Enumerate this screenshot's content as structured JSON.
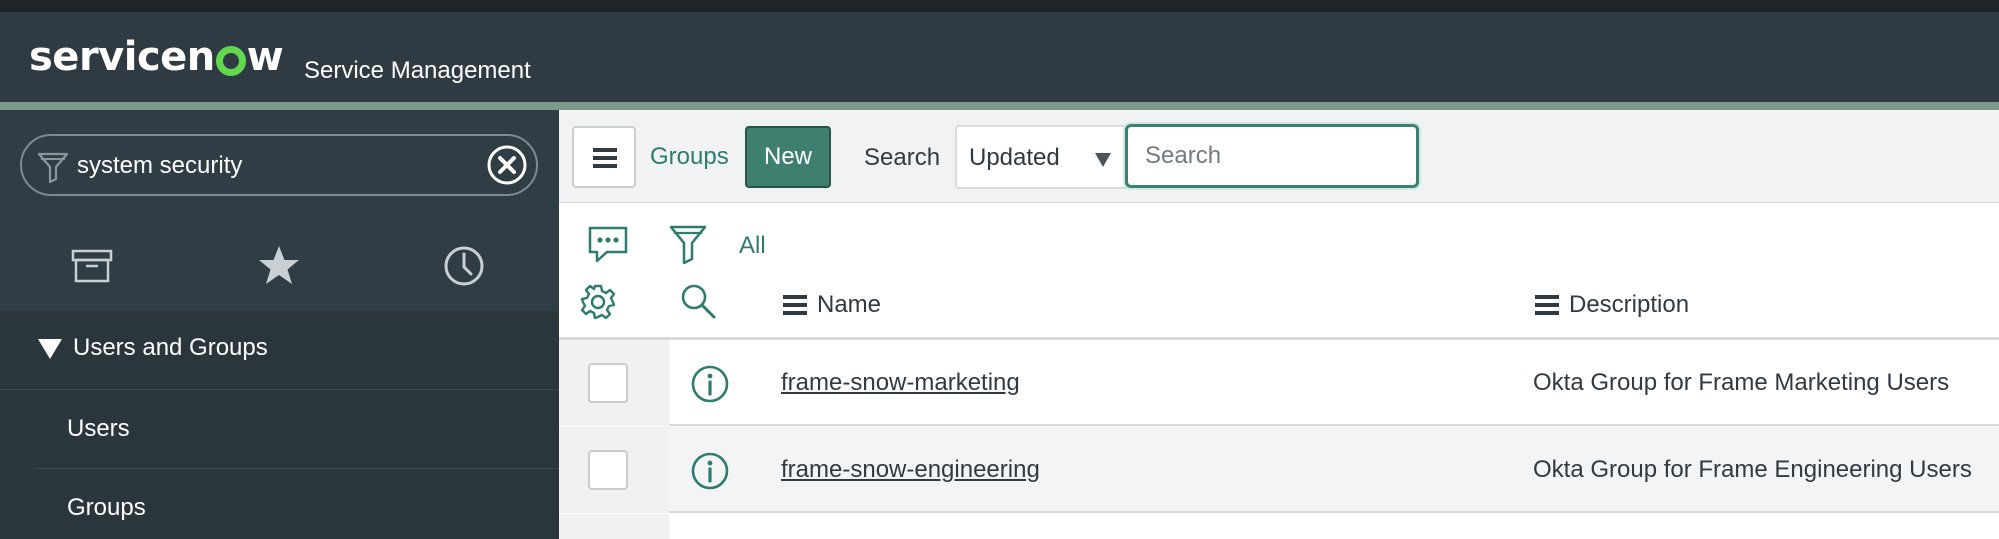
{
  "header": {
    "logo_text": "servicenow",
    "logo_parts": [
      "servicen",
      "w"
    ],
    "app_title": "Service Management",
    "colors": {
      "bar": "#303a42",
      "accent_line": "#7c9a8c",
      "logo_dot": "#62d84e"
    }
  },
  "sidebar": {
    "filter": {
      "value": "system security",
      "icon": "filter-icon",
      "clear_icon": "clear-circle-icon"
    },
    "tabs": [
      {
        "icon": "archive-icon"
      },
      {
        "icon": "star-icon"
      },
      {
        "icon": "clock-icon"
      }
    ],
    "section": {
      "label": "Users and Groups",
      "expanded": true
    },
    "items": [
      {
        "label": "Users"
      },
      {
        "label": "Groups"
      }
    ]
  },
  "toolbar": {
    "menu_icon": "hamburger-icon",
    "list_title": "Groups",
    "new_label": "New",
    "search_label": "Search",
    "search_field": {
      "selected": "Updated"
    },
    "search_input": {
      "placeholder": "Search",
      "value": ""
    }
  },
  "list_controls": {
    "activity_icon": "chat-bubble-icon",
    "filter_icon": "funnel-icon",
    "breadcrumb": "All",
    "settings_icon": "gear-icon",
    "search_icon": "magnifier-icon"
  },
  "table": {
    "columns": [
      {
        "label": "Name"
      },
      {
        "label": "Description"
      }
    ],
    "rows": [
      {
        "name": "frame-snow-marketing",
        "description": "Okta Group for Frame Marketing Users"
      },
      {
        "name": "frame-snow-engineering",
        "description": "Okta Group for Frame Engineering Users"
      }
    ]
  },
  "theme": {
    "accent": "#3f7f6f",
    "link": "#2e7b6f",
    "sidebar_bg": "#2a353c"
  }
}
